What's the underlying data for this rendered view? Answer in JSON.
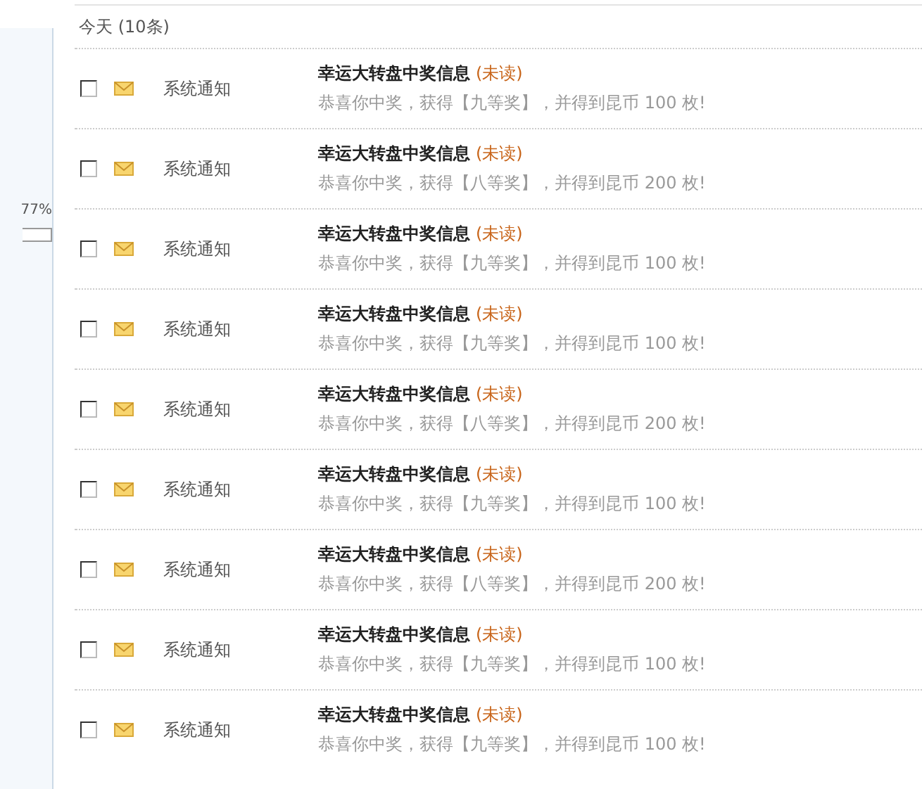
{
  "sidebar": {
    "percent": "77%"
  },
  "section": {
    "title": "今天 (10条)"
  },
  "messages": [
    {
      "checked": false,
      "sender": "系统通知",
      "title": "幸运大转盘中奖信息",
      "status": "(未读)",
      "body": "恭喜你中奖，获得【九等奖】，并得到昆币 100 枚!"
    },
    {
      "checked": false,
      "sender": "系统通知",
      "title": "幸运大转盘中奖信息",
      "status": "(未读)",
      "body": "恭喜你中奖，获得【八等奖】，并得到昆币 200 枚!"
    },
    {
      "checked": false,
      "sender": "系统通知",
      "title": "幸运大转盘中奖信息",
      "status": "(未读)",
      "body": "恭喜你中奖，获得【九等奖】，并得到昆币 100 枚!"
    },
    {
      "checked": false,
      "sender": "系统通知",
      "title": "幸运大转盘中奖信息",
      "status": "(未读)",
      "body": "恭喜你中奖，获得【九等奖】，并得到昆币 100 枚!"
    },
    {
      "checked": false,
      "sender": "系统通知",
      "title": "幸运大转盘中奖信息",
      "status": "(未读)",
      "body": "恭喜你中奖，获得【八等奖】，并得到昆币 200 枚!"
    },
    {
      "checked": false,
      "sender": "系统通知",
      "title": "幸运大转盘中奖信息",
      "status": "(未读)",
      "body": "恭喜你中奖，获得【九等奖】，并得到昆币 100 枚!"
    },
    {
      "checked": false,
      "sender": "系统通知",
      "title": "幸运大转盘中奖信息",
      "status": "(未读)",
      "body": "恭喜你中奖，获得【八等奖】，并得到昆币 200 枚!"
    },
    {
      "checked": false,
      "sender": "系统通知",
      "title": "幸运大转盘中奖信息",
      "status": "(未读)",
      "body": "恭喜你中奖，获得【九等奖】，并得到昆币 100 枚!"
    },
    {
      "checked": false,
      "sender": "系统通知",
      "title": "幸运大转盘中奖信息",
      "status": "(未读)",
      "body": "恭喜你中奖，获得【九等奖】，并得到昆币 100 枚!"
    }
  ]
}
